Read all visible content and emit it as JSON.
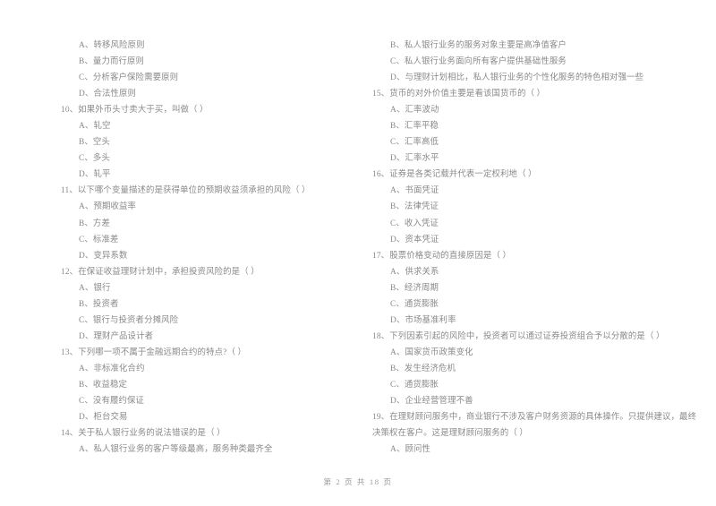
{
  "document": {
    "type": "exam-paper",
    "footer": "第 2 页 共 18 页",
    "page_number": "2",
    "total_pages": "18",
    "text_color": "#8a8a8a",
    "background_color": "#ffffff"
  },
  "left_column": {
    "lines": [
      {
        "kind": "option",
        "text": "A、转移风险原则"
      },
      {
        "kind": "option",
        "text": "B、量力而行原则"
      },
      {
        "kind": "option",
        "text": "C、分析客户保险需要原则"
      },
      {
        "kind": "option",
        "text": "D、合法性原则"
      },
      {
        "kind": "question",
        "text": "10、如果外币头寸卖大于买，叫做（        ）"
      },
      {
        "kind": "option",
        "text": "A、轧空"
      },
      {
        "kind": "option",
        "text": "B、空头"
      },
      {
        "kind": "option",
        "text": "C、多头"
      },
      {
        "kind": "option",
        "text": "D、轧平"
      },
      {
        "kind": "question",
        "text": "11、以下哪个变量描述的是获得单位的预期收益须承担的风险（        ）"
      },
      {
        "kind": "option",
        "text": "A、预期收益率"
      },
      {
        "kind": "option",
        "text": "B、方差"
      },
      {
        "kind": "option",
        "text": "C、标准差"
      },
      {
        "kind": "option",
        "text": "D、变异系数"
      },
      {
        "kind": "question",
        "text": "12、在保证收益理财计划中，承担投资风险的是（        ）"
      },
      {
        "kind": "option",
        "text": "A、银行"
      },
      {
        "kind": "option",
        "text": "B、投资者"
      },
      {
        "kind": "option",
        "text": "C、银行与投资者分摊风险"
      },
      {
        "kind": "option",
        "text": "D、理财产品设计者"
      },
      {
        "kind": "question",
        "text": "13、下列哪一项不属于金融远期合约的特点?（        ）"
      },
      {
        "kind": "option",
        "text": "A、非标准化合约"
      },
      {
        "kind": "option",
        "text": "B、收益稳定"
      },
      {
        "kind": "option",
        "text": "C、没有履约保证"
      },
      {
        "kind": "option",
        "text": "D、柜台交易"
      },
      {
        "kind": "question",
        "text": "14、关于私人银行业务的说法错误的是（        ）"
      },
      {
        "kind": "option",
        "text": "A、私人银行业务的客户等级最高，服务种类最齐全"
      }
    ]
  },
  "right_column": {
    "lines": [
      {
        "kind": "option",
        "text": "B、私人银行业务的服务对象主要是高净值客户"
      },
      {
        "kind": "option",
        "text": "C、私人银行业务面向所有客户提供基础性服务"
      },
      {
        "kind": "option",
        "text": "D、与理财计划相比，私人银行业务的个性化服务的特色相对强一些"
      },
      {
        "kind": "question",
        "text": "15、货币的对外价值主要是看该国货币的（        ）"
      },
      {
        "kind": "option",
        "text": "A、汇率波动"
      },
      {
        "kind": "option",
        "text": "B、汇率平稳"
      },
      {
        "kind": "option",
        "text": "C、汇率高低"
      },
      {
        "kind": "option",
        "text": "D、汇率水平"
      },
      {
        "kind": "question",
        "text": "16、证券是各类记载并代表一定权利地（        ）"
      },
      {
        "kind": "option",
        "text": "A、书面凭证"
      },
      {
        "kind": "option",
        "text": "B、法律凭证"
      },
      {
        "kind": "option",
        "text": "C、收入凭证"
      },
      {
        "kind": "option",
        "text": "D、资本凭证"
      },
      {
        "kind": "question",
        "text": "17、股票价格变动的直接原因是（        ）"
      },
      {
        "kind": "option",
        "text": "A、供求关系"
      },
      {
        "kind": "option",
        "text": "B、经济周期"
      },
      {
        "kind": "option",
        "text": "C、通货膨胀"
      },
      {
        "kind": "option",
        "text": "D、市场基准利率"
      },
      {
        "kind": "question",
        "text": "18、下列因素引起的风险中，投资者可以通过证券投资组合予以分散的是（        ）"
      },
      {
        "kind": "option",
        "text": "A、国家货币政策变化"
      },
      {
        "kind": "option",
        "text": "B、发生经济危机"
      },
      {
        "kind": "option",
        "text": "C、通货膨胀"
      },
      {
        "kind": "option",
        "text": "D、企业经营管理不善"
      },
      {
        "kind": "question-wrap",
        "text": "19、在理财顾问服务中，商业银行不涉及客户财务资源的具体操作。只提供建议，最终决策权在客户。这是理财顾问服务的（        ）"
      },
      {
        "kind": "option",
        "text": "A、顾问性"
      }
    ]
  }
}
